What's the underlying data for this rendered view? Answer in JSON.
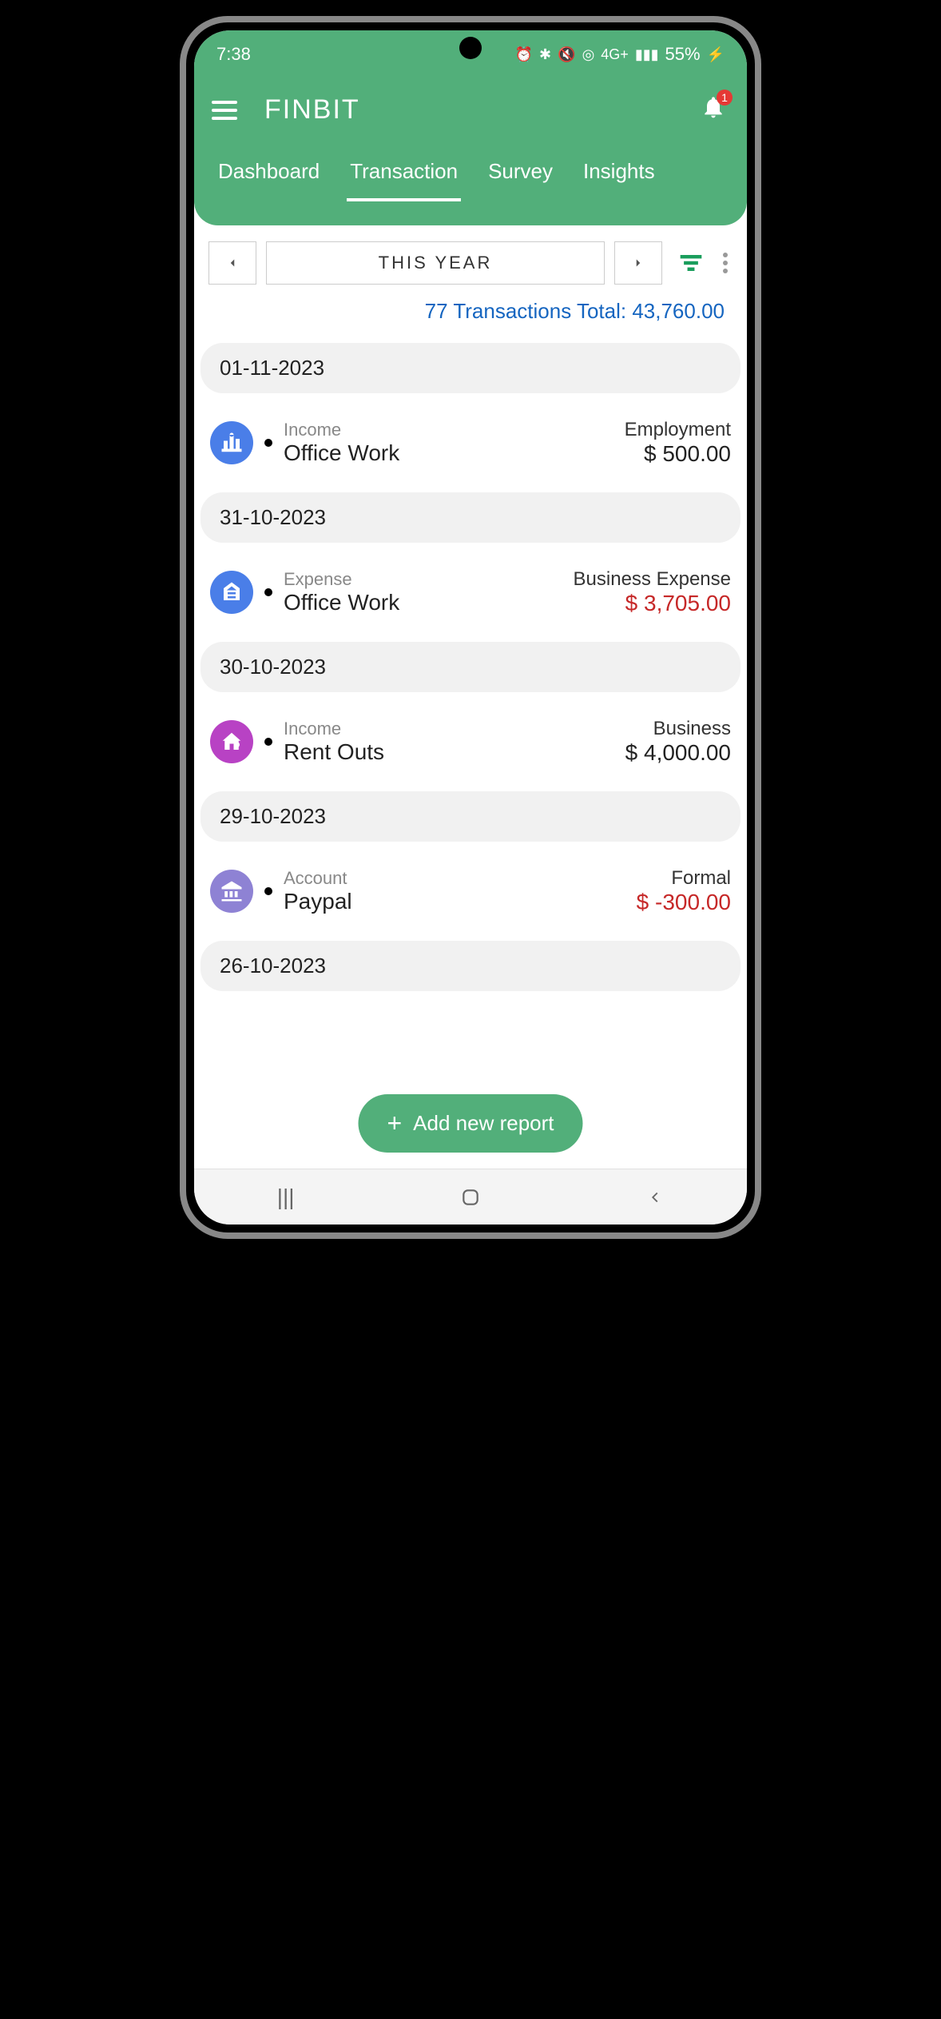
{
  "status": {
    "time": "7:38",
    "battery": "55%"
  },
  "header": {
    "title": "FINBIT",
    "notification_count": "1"
  },
  "tabs": [
    {
      "label": "Dashboard",
      "active": false
    },
    {
      "label": "Transaction",
      "active": true
    },
    {
      "label": "Survey",
      "active": false
    },
    {
      "label": "Insights",
      "active": false
    }
  ],
  "date_range": "THIS YEAR",
  "summary": "77 Transactions Total: 43,760.00",
  "transactions": [
    {
      "date": "01-11-2023",
      "items": [
        {
          "type": "Income",
          "name": "Office Work",
          "category": "Employment",
          "amount": "$ 500.00",
          "amount_color": "black",
          "icon": "office",
          "icon_color": "blue"
        }
      ]
    },
    {
      "date": "31-10-2023",
      "items": [
        {
          "type": "Expense",
          "name": "Office Work",
          "category": "Business Expense",
          "amount": "$ 3,705.00",
          "amount_color": "red",
          "icon": "business",
          "icon_color": "blue"
        }
      ]
    },
    {
      "date": "30-10-2023",
      "items": [
        {
          "type": "Income",
          "name": "Rent Outs",
          "category": "Business",
          "amount": "$ 4,000.00",
          "amount_color": "black",
          "icon": "house",
          "icon_color": "purple"
        }
      ]
    },
    {
      "date": "29-10-2023",
      "items": [
        {
          "type": "Account",
          "name": "Paypal",
          "category": "Formal",
          "amount": "$ -300.00",
          "amount_color": "red",
          "icon": "bank",
          "icon_color": "lavender"
        }
      ]
    },
    {
      "date": "26-10-2023",
      "items": []
    }
  ],
  "fab_label": "Add new report"
}
